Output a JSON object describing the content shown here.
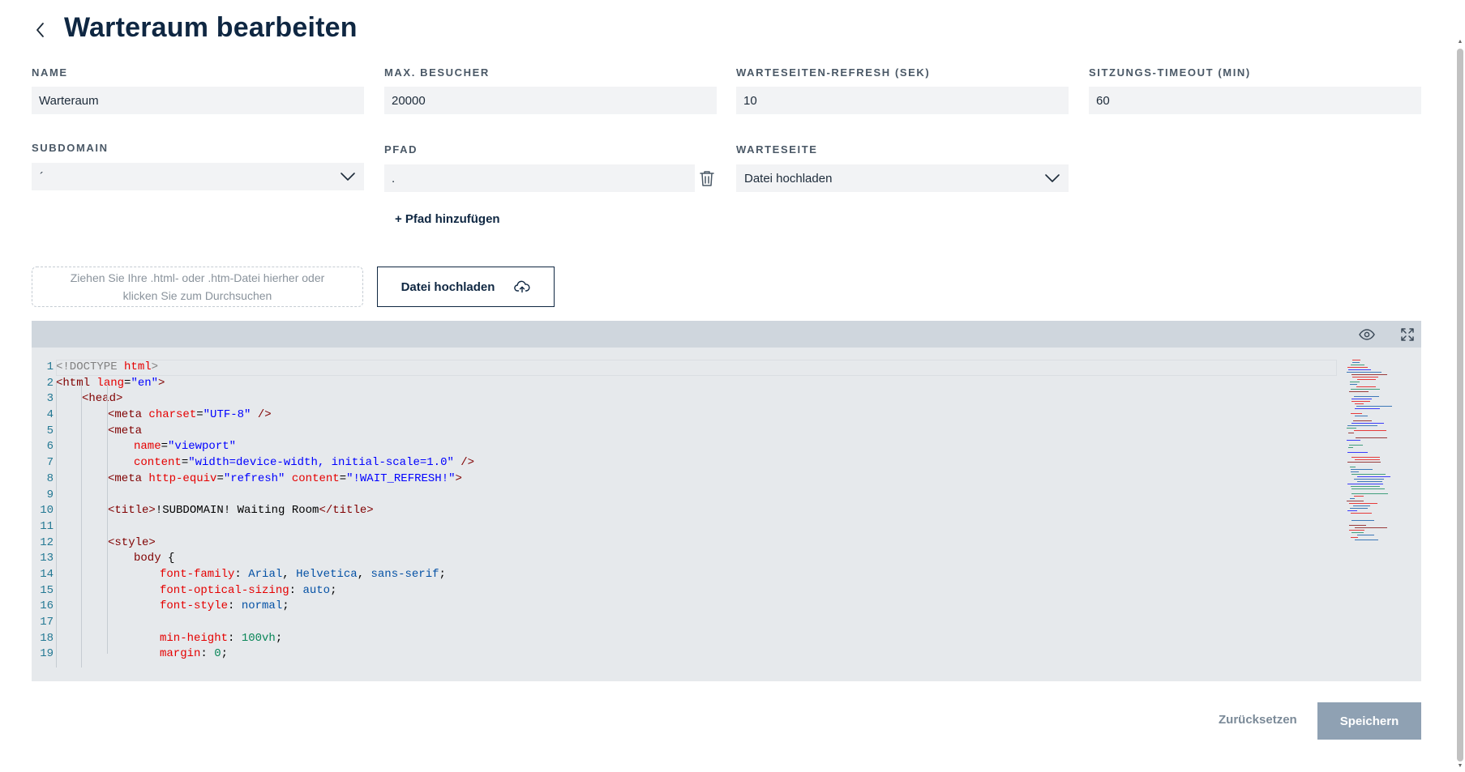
{
  "header": {
    "title": "Warteraum bearbeiten"
  },
  "fields": {
    "name": {
      "label": "NAME",
      "value": "Warteraum"
    },
    "max_visitors": {
      "label": "MAX. BESUCHER",
      "value": "20000"
    },
    "refresh": {
      "label": "WARTESEITEN-REFRESH (SEK)",
      "value": "10"
    },
    "timeout": {
      "label": "SITZUNGS-TIMEOUT (MIN)",
      "value": "60"
    },
    "subdomain": {
      "label": "SUBDOMAIN",
      "value": "´"
    },
    "path": {
      "label": "PFAD",
      "value": "."
    },
    "waiting_page": {
      "label": "WARTESEITE",
      "value": "Datei hochladen"
    }
  },
  "add_path_label": "+ Pfad hinzufügen",
  "dropzone_text": "Ziehen Sie Ihre .html- oder .htm-Datei hierher oder klicken Sie zum Durchsuchen",
  "upload_button_label": "Datei hochladen",
  "code_lines": [
    {
      "n": "1",
      "indent": 0,
      "tokens": [
        [
          "d",
          "<!DOCTYPE "
        ],
        [
          "a",
          "html"
        ],
        [
          "d",
          ">"
        ]
      ]
    },
    {
      "n": "2",
      "indent": 0,
      "tokens": [
        [
          "t",
          "<html "
        ],
        [
          "a",
          "lang"
        ],
        [
          "p",
          "="
        ],
        [
          "s",
          "\"en\""
        ],
        [
          "t",
          ">"
        ]
      ]
    },
    {
      "n": "3",
      "indent": 1,
      "tokens": [
        [
          "t",
          "<head>"
        ]
      ]
    },
    {
      "n": "4",
      "indent": 2,
      "tokens": [
        [
          "t",
          "<meta "
        ],
        [
          "a",
          "charset"
        ],
        [
          "p",
          "="
        ],
        [
          "s",
          "\"UTF-8\""
        ],
        [
          "t",
          " />"
        ]
      ]
    },
    {
      "n": "5",
      "indent": 2,
      "tokens": [
        [
          "t",
          "<meta"
        ]
      ]
    },
    {
      "n": "6",
      "indent": 3,
      "tokens": [
        [
          "a",
          "name"
        ],
        [
          "p",
          "="
        ],
        [
          "s",
          "\"viewport\""
        ]
      ]
    },
    {
      "n": "7",
      "indent": 3,
      "tokens": [
        [
          "a",
          "content"
        ],
        [
          "p",
          "="
        ],
        [
          "s",
          "\"width=device-width, initial-scale=1.0\""
        ],
        [
          "t",
          " />"
        ]
      ]
    },
    {
      "n": "8",
      "indent": 2,
      "tokens": [
        [
          "t",
          "<meta "
        ],
        [
          "a",
          "http-equiv"
        ],
        [
          "p",
          "="
        ],
        [
          "s",
          "\"refresh\""
        ],
        [
          "p",
          " "
        ],
        [
          "a",
          "content"
        ],
        [
          "p",
          "="
        ],
        [
          "s",
          "\"!WAIT_REFRESH!\""
        ],
        [
          "t",
          ">"
        ]
      ]
    },
    {
      "n": "9",
      "indent": 0,
      "tokens": []
    },
    {
      "n": "10",
      "indent": 2,
      "tokens": [
        [
          "t",
          "<title>"
        ],
        [
          "p",
          "!SUBDOMAIN! Waiting Room"
        ],
        [
          "t",
          "</title>"
        ]
      ]
    },
    {
      "n": "11",
      "indent": 0,
      "tokens": []
    },
    {
      "n": "12",
      "indent": 2,
      "tokens": [
        [
          "t",
          "<style>"
        ]
      ]
    },
    {
      "n": "13",
      "indent": 3,
      "tokens": [
        [
          "t",
          "body "
        ],
        [
          "p",
          "{"
        ]
      ]
    },
    {
      "n": "14",
      "indent": 4,
      "tokens": [
        [
          "a",
          "font-family"
        ],
        [
          "p",
          ": "
        ],
        [
          "k",
          "Arial"
        ],
        [
          "p",
          ", "
        ],
        [
          "k",
          "Helvetica"
        ],
        [
          "p",
          ", "
        ],
        [
          "k",
          "sans-serif"
        ],
        [
          "p",
          ";"
        ]
      ]
    },
    {
      "n": "15",
      "indent": 4,
      "tokens": [
        [
          "a",
          "font-optical-sizing"
        ],
        [
          "p",
          ": "
        ],
        [
          "k",
          "auto"
        ],
        [
          "p",
          ";"
        ]
      ]
    },
    {
      "n": "16",
      "indent": 4,
      "tokens": [
        [
          "a",
          "font-style"
        ],
        [
          "p",
          ": "
        ],
        [
          "k",
          "normal"
        ],
        [
          "p",
          ";"
        ]
      ]
    },
    {
      "n": "17",
      "indent": 0,
      "tokens": []
    },
    {
      "n": "18",
      "indent": 4,
      "tokens": [
        [
          "a",
          "min-height"
        ],
        [
          "p",
          ": "
        ],
        [
          "n",
          "100vh"
        ],
        [
          "p",
          ";"
        ]
      ]
    },
    {
      "n": "19",
      "indent": 4,
      "tokens": [
        [
          "a",
          "margin"
        ],
        [
          "p",
          ": "
        ],
        [
          "n",
          "0"
        ],
        [
          "p",
          ";"
        ]
      ]
    }
  ],
  "footer": {
    "reset_label": "Zurücksetzen",
    "save_label": "Speichern"
  }
}
